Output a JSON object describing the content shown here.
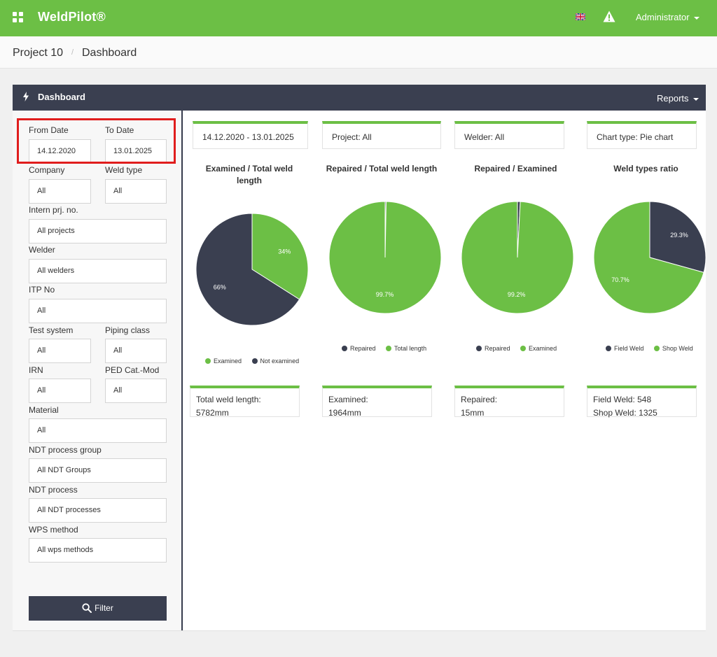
{
  "app": {
    "name": "WeldPilot®"
  },
  "header": {
    "user": "Administrator"
  },
  "breadcrumb": {
    "project": "Project 10",
    "page": "Dashboard",
    "separator": "/"
  },
  "panel": {
    "title": "Dashboard",
    "reports_label": "Reports"
  },
  "filters": {
    "from_date": {
      "label": "From Date",
      "value": "14.12.2020"
    },
    "to_date": {
      "label": "To Date",
      "value": "13.01.2025"
    },
    "company": {
      "label": "Company",
      "value": "All"
    },
    "weld_type": {
      "label": "Weld type",
      "value": "All"
    },
    "intern_prj": {
      "label": "Intern prj. no.",
      "value": "All projects"
    },
    "welder": {
      "label": "Welder",
      "value": "All welders"
    },
    "itp_no": {
      "label": "ITP No",
      "value": "All"
    },
    "test_system": {
      "label": "Test system",
      "value": "All"
    },
    "piping_class": {
      "label": "Piping class",
      "value": "All"
    },
    "irn": {
      "label": "IRN",
      "value": "All"
    },
    "ped_cat": {
      "label": "PED Cat.-Mod",
      "value": "All"
    },
    "material": {
      "label": "Material",
      "value": "All"
    },
    "ndt_group": {
      "label": "NDT process group",
      "value": "All NDT Groups"
    },
    "ndt_process": {
      "label": "NDT process",
      "value": "All NDT processes"
    },
    "wps_method": {
      "label": "WPS method",
      "value": "All wps methods"
    },
    "filter_button": "Filter"
  },
  "summary": {
    "date_range": "14.12.2020 - 13.01.2025",
    "project": "Project: All",
    "welder": "Welder: All",
    "chart_type": "Chart type: Pie chart"
  },
  "colors": {
    "green": "#6cbf45",
    "dark": "#3a3f50"
  },
  "chart_data": [
    {
      "type": "pie",
      "title": "Examined / Total weld length",
      "series": [
        {
          "name": "Examined",
          "value": 34,
          "label": "34%",
          "color": "#6cbf45"
        },
        {
          "name": "Not examined",
          "value": 66,
          "label": "66%",
          "color": "#3a3f50"
        }
      ]
    },
    {
      "type": "pie",
      "title": "Repaired / Total weld length",
      "series": [
        {
          "name": "Repaired",
          "value": 0.3,
          "label": "",
          "color": "#3a3f50"
        },
        {
          "name": "Total length",
          "value": 99.7,
          "label": "99.7%",
          "color": "#6cbf45"
        }
      ]
    },
    {
      "type": "pie",
      "title": "Repaired / Examined",
      "series": [
        {
          "name": "Repaired",
          "value": 0.8,
          "label": "",
          "color": "#3a3f50"
        },
        {
          "name": "Examined",
          "value": 99.2,
          "label": "99.2%",
          "color": "#6cbf45"
        }
      ]
    },
    {
      "type": "pie",
      "title": "Weld types ratio",
      "series": [
        {
          "name": "Field Weld",
          "value": 29.3,
          "label": "29.3%",
          "color": "#3a3f50"
        },
        {
          "name": "Shop Weld",
          "value": 70.7,
          "label": "70.7%",
          "color": "#6cbf45"
        }
      ]
    }
  ],
  "stats": [
    {
      "line1": "Total weld length:",
      "line2": "5782mm"
    },
    {
      "line1": "Examined:",
      "line2": "1964mm"
    },
    {
      "line1": "Repaired:",
      "line2": "15mm"
    },
    {
      "line1": "Field Weld: 548",
      "line2": "Shop Weld: 1325"
    }
  ]
}
